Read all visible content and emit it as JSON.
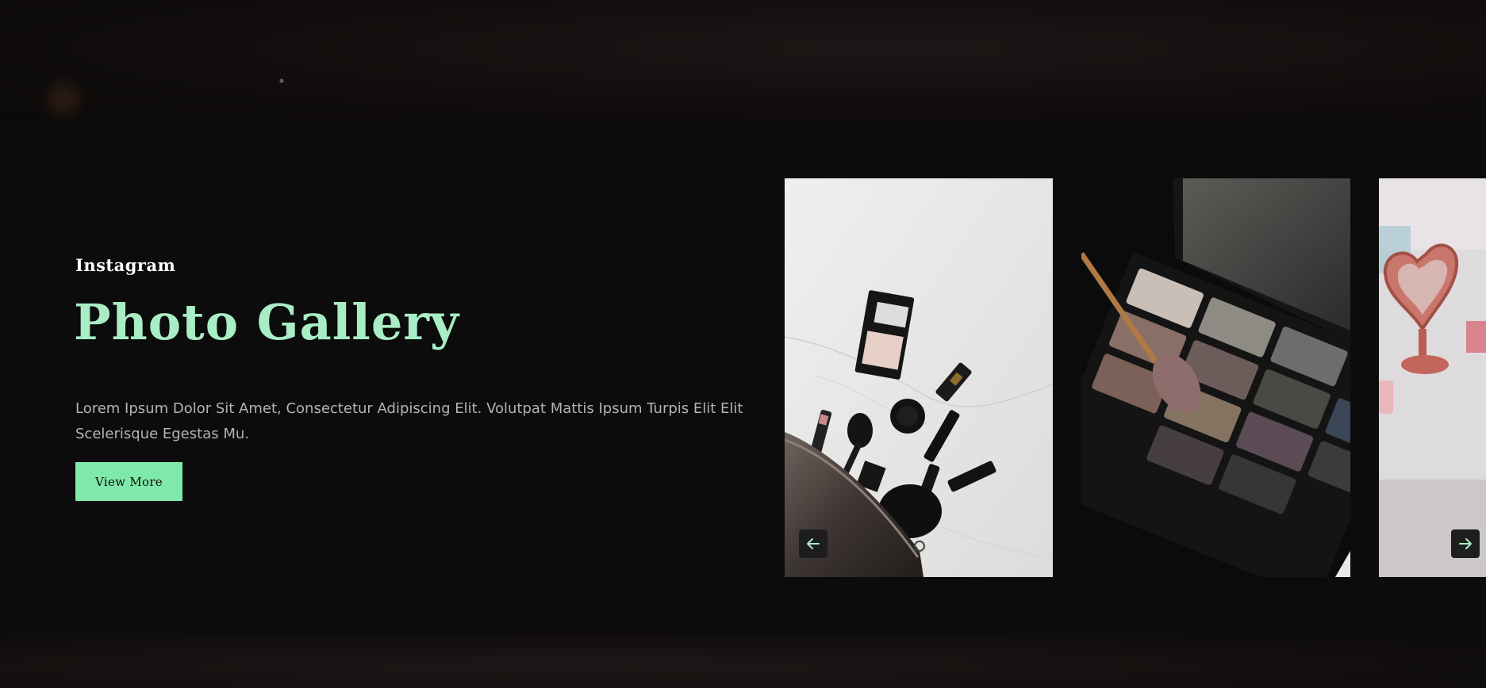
{
  "hero": {
    "eyebrow": "Instagram",
    "title": "Photo Gallery",
    "description": "Lorem Ipsum Dolor Sit Amet, Consectetur Adipiscing Elit. Volutpat Mattis Ipsum Turpis Elit Elit Scelerisque Egestas Mu.",
    "button_label": "View More"
  },
  "gallery": {
    "photos": [
      {
        "subject": "makeup products on white marble"
      },
      {
        "subject": "eyeshadow palette with brush"
      },
      {
        "subject": "heart-shaped rose gold mirror"
      }
    ],
    "prev_icon": "arrow-left-icon",
    "next_icon": "arrow-right-icon"
  },
  "colors": {
    "accent": "#7fe9a9",
    "title": "#a9edc5",
    "background": "#0c0c0c"
  }
}
